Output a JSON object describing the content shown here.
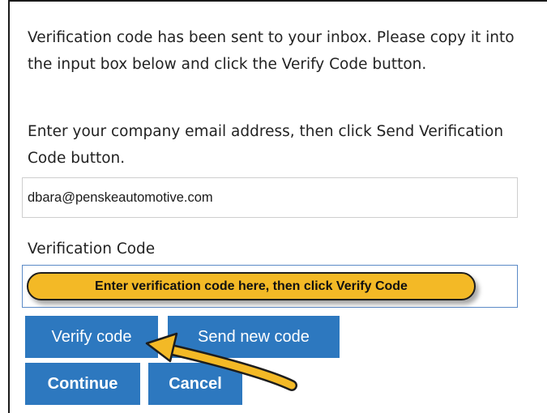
{
  "messages": {
    "sent_notice": "Verification code has been sent to your inbox. Please copy it into the input box below and click the Verify Code button.",
    "email_instruction": "Enter your company email address, then click Send Verification Code button."
  },
  "email": {
    "value": "dbara@penskeautomotive.com"
  },
  "verification": {
    "label": "Verification Code",
    "value": ""
  },
  "callout": {
    "text": "Enter verification code here, then click Verify Code",
    "color": "#f3b926"
  },
  "buttons": {
    "verify": "Verify code",
    "send_new": "Send new code",
    "continue": "Continue",
    "cancel": "Cancel",
    "color": "#2d78bf"
  },
  "annotations": {
    "arrow_icon": "arrow-pointing-icon",
    "arrow_color": "#f3b926"
  }
}
